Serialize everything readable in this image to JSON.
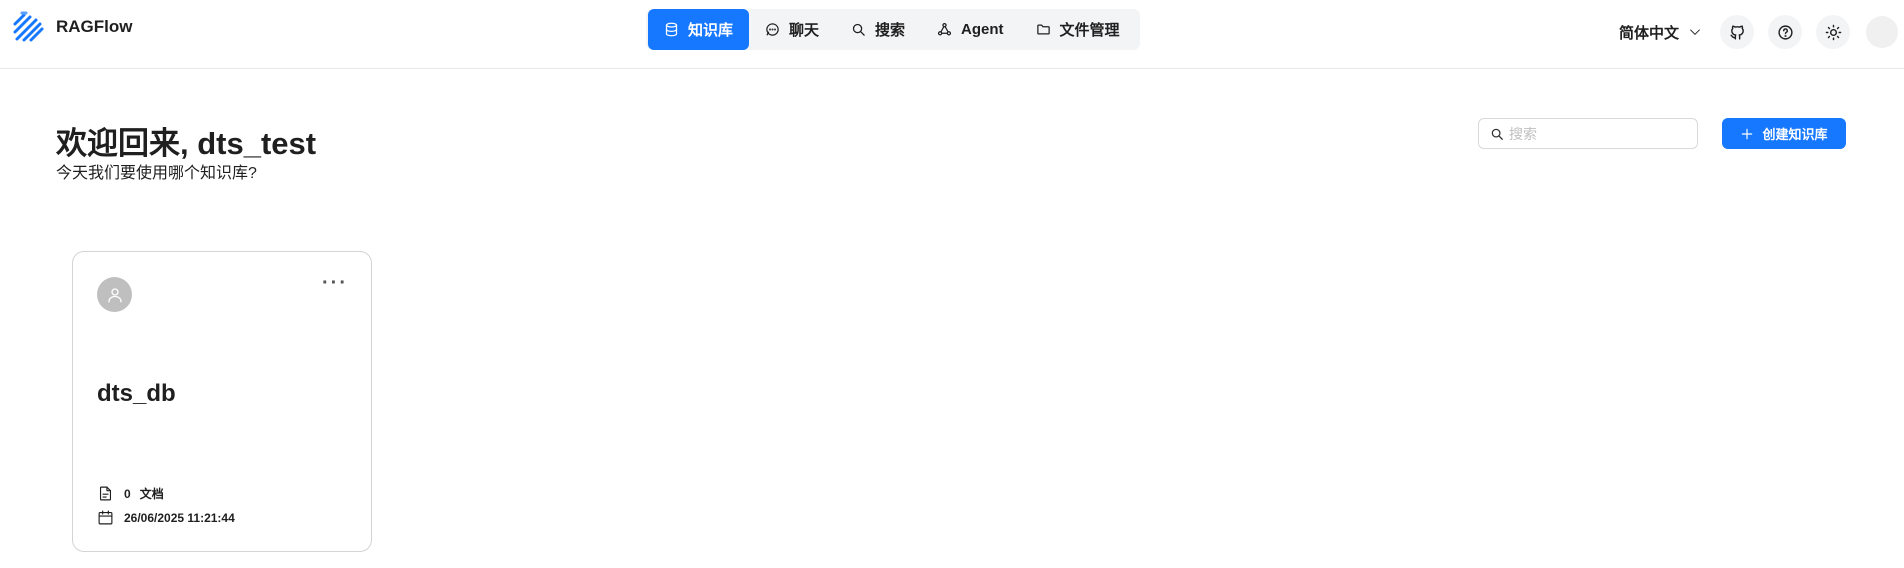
{
  "app": {
    "name": "RAGFlow"
  },
  "nav": {
    "items": [
      {
        "label": "知识库",
        "icon": "database-icon",
        "active": true
      },
      {
        "label": "聊天",
        "icon": "chat-icon",
        "active": false
      },
      {
        "label": "搜索",
        "icon": "search-icon",
        "active": false
      },
      {
        "label": "Agent",
        "icon": "agent-icon",
        "active": false
      },
      {
        "label": "文件管理",
        "icon": "folder-icon",
        "active": false
      }
    ]
  },
  "header": {
    "language": "简体中文",
    "icons": [
      "github-icon",
      "help-icon",
      "theme-sun-icon",
      "user-avatar"
    ]
  },
  "welcome": {
    "title": "欢迎回来, dts_test",
    "subtitle": "今天我们要使用哪个知识库?"
  },
  "search": {
    "placeholder": "搜索",
    "value": ""
  },
  "actions": {
    "create_label": "创建知识库"
  },
  "knowledge_bases": [
    {
      "name": "dts_db",
      "doc_count": "0",
      "doc_label": "文档",
      "created": "26/06/2025 11:21:44"
    }
  ],
  "colors": {
    "accent": "#1677ff",
    "nav_bg": "#f3f4f6",
    "card_border": "#d4d4d4",
    "avatar": "#bfbfbf"
  }
}
